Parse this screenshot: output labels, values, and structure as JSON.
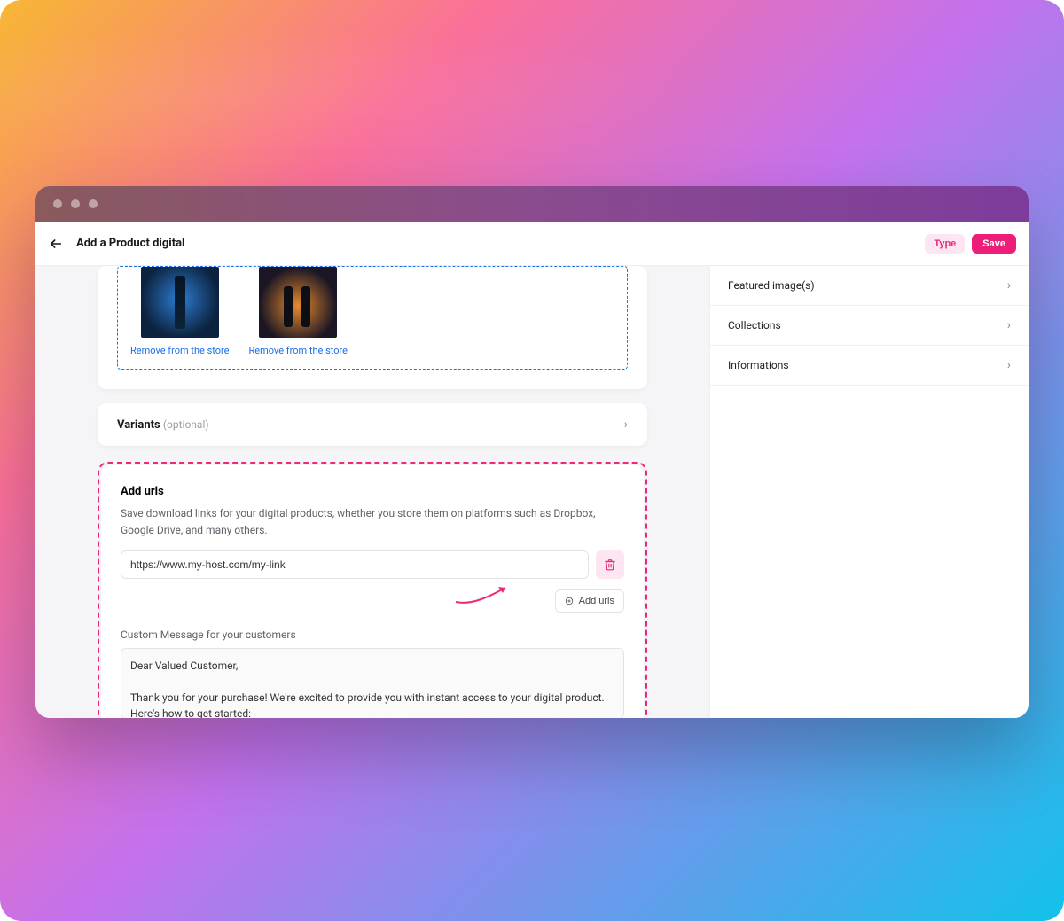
{
  "header": {
    "title": "Add a Product digital",
    "type_label": "Type",
    "save_label": "Save"
  },
  "images": {
    "remove_label": "Remove from the store"
  },
  "variants": {
    "title": "Variants",
    "optional": "(optional)"
  },
  "urls": {
    "heading": "Add urls",
    "description": "Save download links for your digital products, whether you store them on platforms such as Dropbox, Google Drive, and many others.",
    "input_value": "https://www.my-host.com/my-link",
    "add_button": "Add urls",
    "custom_message_label": "Custom Message for your customers",
    "custom_message_value": "Dear Valued Customer,\n\nThank you for your purchase! We're excited to provide you with instant access to your digital product. Here's how to get started:"
  },
  "sidebar": {
    "items": [
      "Featured image(s)",
      "Collections",
      "Informations"
    ]
  },
  "colors": {
    "accent": "#ec1e79"
  }
}
